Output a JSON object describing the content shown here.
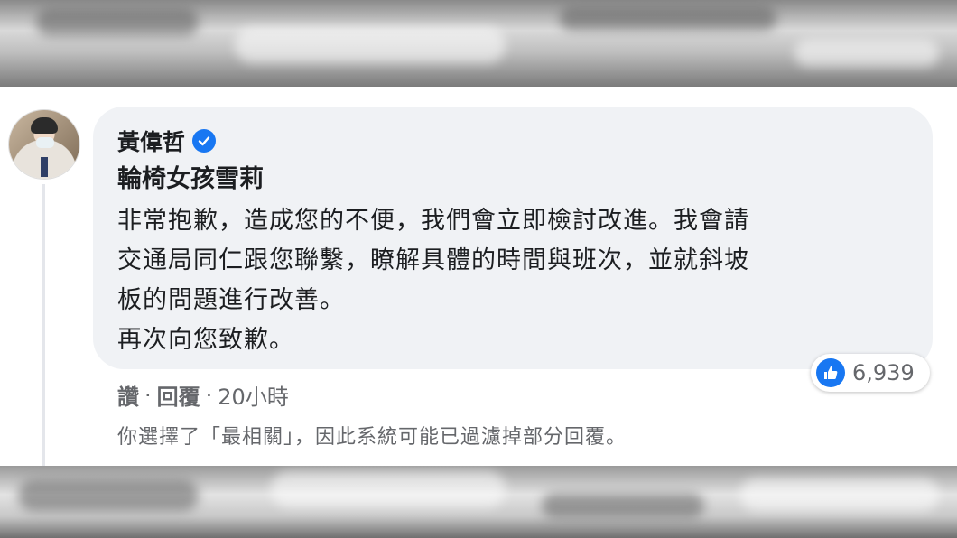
{
  "comment": {
    "author": "黃偉哲",
    "verified_icon": "verified-badge-icon",
    "mention": "輪椅女孩雪莉",
    "body_lines": [
      "非常抱歉，造成您的不便，我們會立即檢討改進。我會請",
      "交通局同仁跟您聯繫，瞭解具體的時間與班次，並就斜坡",
      "板的問題進行改善。",
      "再次向您致歉。"
    ],
    "reaction": {
      "icon": "like-icon",
      "count": "6,939"
    },
    "actions": {
      "like": "讚",
      "reply": "回覆",
      "time": "20小時",
      "separator": "·"
    },
    "filter_note": "你選擇了「最相關」，因此系統可能已過濾掉部分回覆。"
  },
  "colors": {
    "bubble": "#f0f2f5",
    "secondary_text": "#65676b",
    "primary_text": "#1c1e21",
    "accent": "#1877f2"
  }
}
